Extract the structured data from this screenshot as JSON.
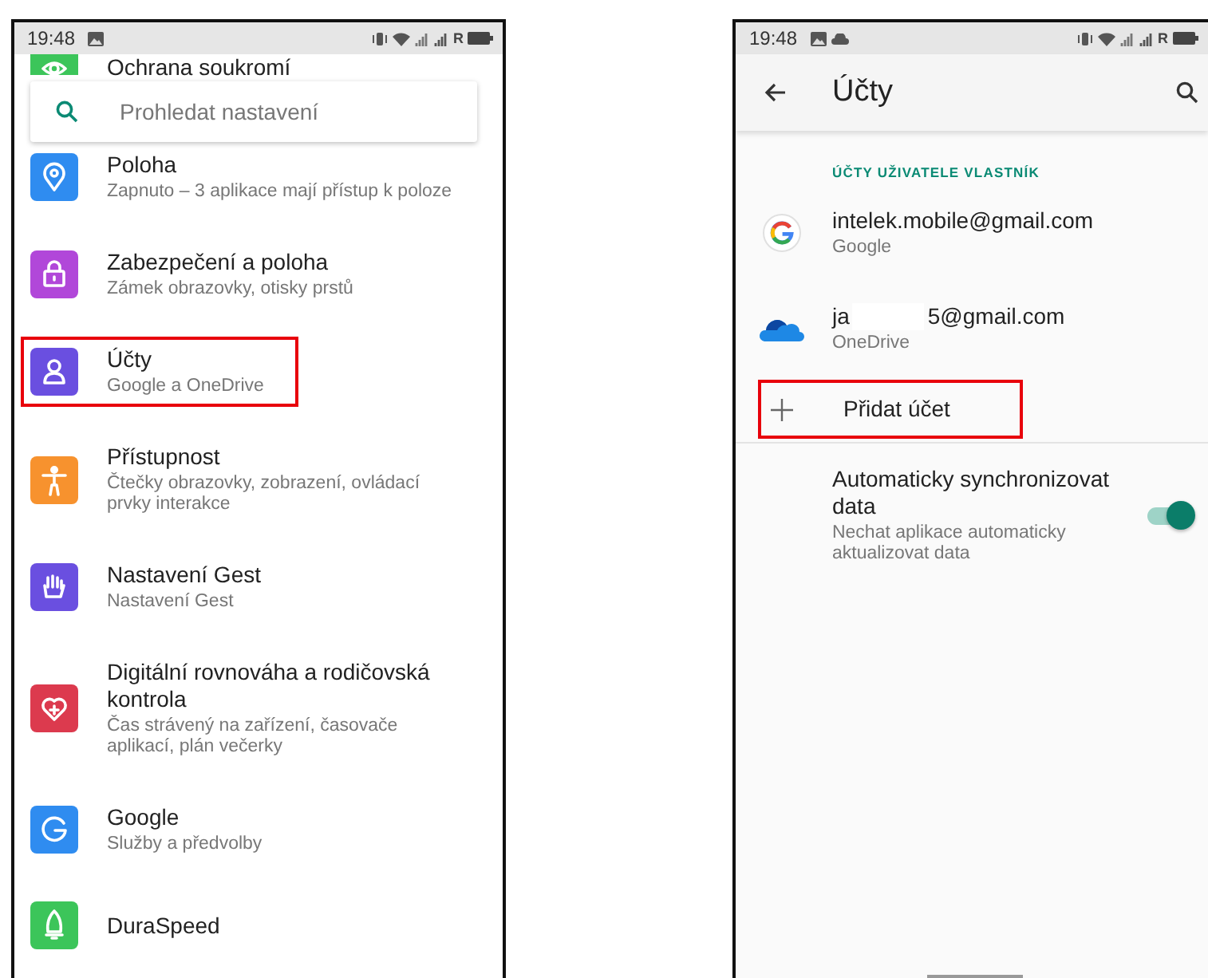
{
  "left_screen": {
    "status_bar": {
      "time": "19:48",
      "notification_icons": [
        {
          "kind": "image"
        }
      ],
      "network_label": "R"
    },
    "search": {
      "placeholder": "Prohledat nastavení"
    },
    "items": [
      {
        "kind": "privacy",
        "color": "#3cc55a",
        "title": "Ochrana soukromí",
        "highlighted": false
      },
      {
        "kind": "location",
        "color": "#2f8cf0",
        "title": "Poloha",
        "subtitle": "Zapnuto – 3 aplikace mají přístup k poloze",
        "highlighted": false
      },
      {
        "kind": "lock",
        "color": "#b147d9",
        "title": "Zabezpečení a poloha",
        "subtitle": "Zámek obrazovky, otisky prstů",
        "highlighted": false
      },
      {
        "kind": "person",
        "color": "#6a4fe0",
        "title": "Účty",
        "subtitle": "Google a OneDrive",
        "highlighted": true
      },
      {
        "kind": "accessibility",
        "color": "#f7922e",
        "title": "Přístupnost",
        "subtitle": "Čtečky obrazovky, zobrazení, ovládací prvky interakce",
        "highlighted": false
      },
      {
        "kind": "hand",
        "color": "#6a4fe0",
        "title": "Nastavení Gest",
        "subtitle": "Nastavení Gest",
        "highlighted": false
      },
      {
        "kind": "heart",
        "color": "#dc3a4e",
        "title": "Digitální rovnováha a rodičovská kontrola",
        "subtitle": "Čas strávený na zařízení, časovače aplikací, plán večerky",
        "highlighted": false
      },
      {
        "kind": "google",
        "color": "#2f8cf0",
        "title": "Google",
        "subtitle": "Služby a předvolby",
        "highlighted": false
      },
      {
        "kind": "rocket",
        "color": "#3cc55a",
        "title": "DuraSpeed",
        "highlighted": false
      }
    ]
  },
  "right_screen": {
    "status_bar": {
      "time": "19:48",
      "notification_icons": [
        {
          "kind": "image"
        },
        {
          "kind": "cloud"
        }
      ],
      "network_label": "R"
    },
    "app_bar": {
      "title": "Účty"
    },
    "section_header": "ÚČTY UŽIVATELE VLASTNÍK",
    "accounts": [
      {
        "kind": "google",
        "email_parts": [
          "intelek.mobile@gmail.com"
        ],
        "provider": "Google"
      },
      {
        "kind": "onedrive",
        "email_parts": [
          "ja",
          "5@gmail.com"
        ],
        "provider": "OneDrive"
      }
    ],
    "add_account": {
      "label": "Přidat účet",
      "highlighted": true
    },
    "sync": {
      "title": "Automaticky synchronizovat data",
      "subtitle": "Nechat aplikace automaticky aktualizovat data",
      "on": true
    }
  }
}
